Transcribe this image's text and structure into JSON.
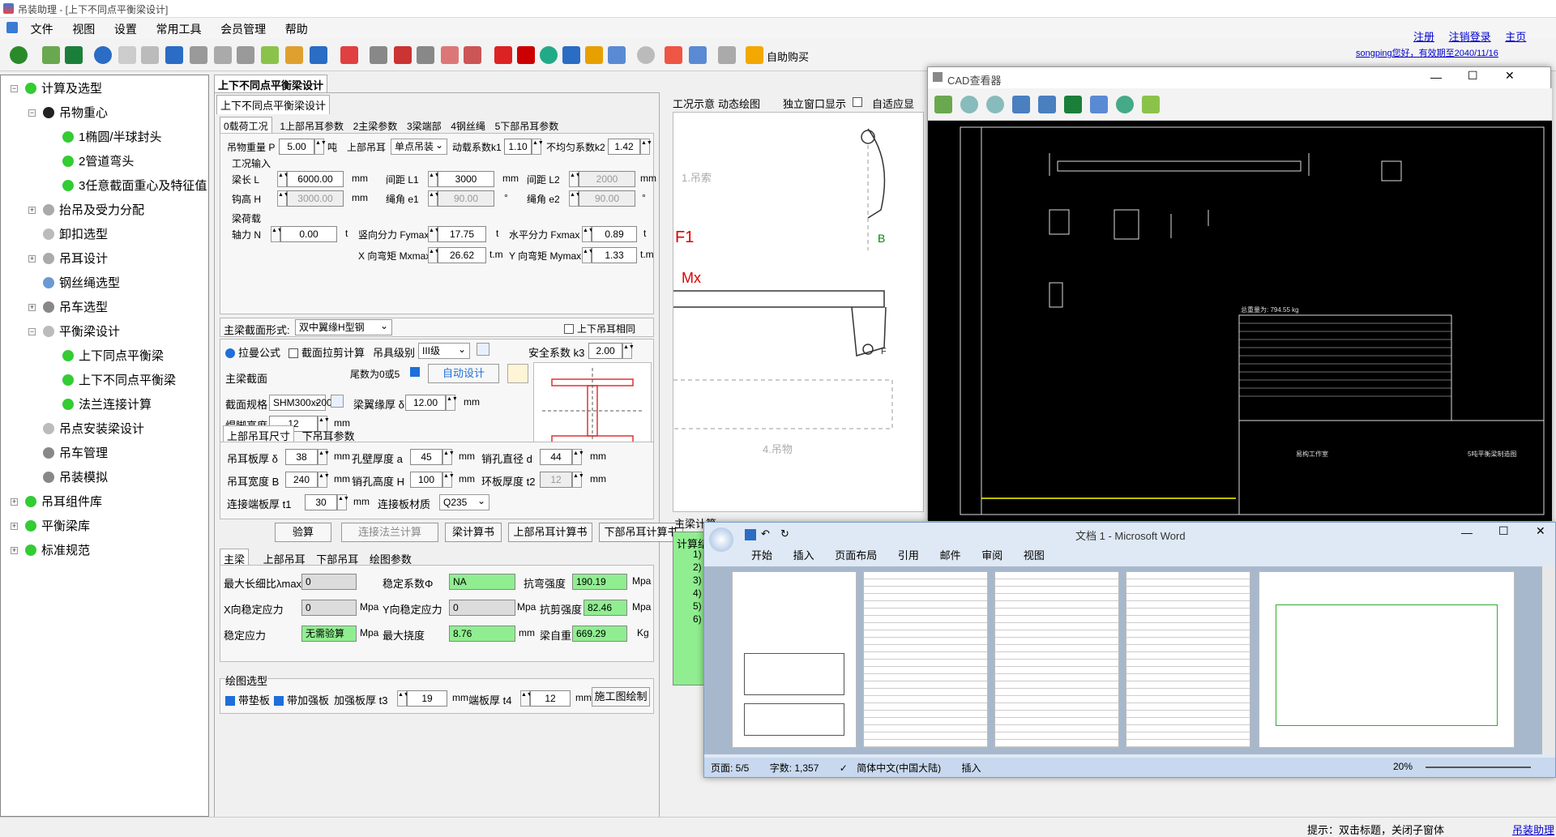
{
  "app": {
    "title": "吊装助理 - [上下不同点平衡梁设计]"
  },
  "menu": [
    "文件",
    "视图",
    "设置",
    "常用工具",
    "会员管理",
    "帮助"
  ],
  "toolbar": {
    "buy": "自助购买"
  },
  "links": {
    "register": "注册",
    "logout": "注销登录",
    "home": "主页",
    "user": "songping您好，有效期至2040/11/16"
  },
  "tree": {
    "calc": "计算及选型",
    "load_cg": "吊物重心",
    "cg1": "1椭圆/半球封头",
    "cg2": "2管道弯头",
    "cg3": "3任意截面重心及特征值",
    "lift": "抬吊及受力分配",
    "unload": "卸扣选型",
    "lug": "吊耳设计",
    "rope": "钢丝绳选型",
    "crane": "吊车选型",
    "beam": "平衡梁设计",
    "beam1": "上下同点平衡梁",
    "beam2": "上下不同点平衡梁",
    "beam3": "法兰连接计算",
    "hook_beam": "吊点安装梁设计",
    "crane_mgr": "吊车管理",
    "sim": "吊装模拟",
    "lug_lib": "吊耳组件库",
    "beam_lib": "平衡梁库",
    "std": "标准规范"
  },
  "doc_tab": "上下不同点平衡梁设计",
  "panel_title": "上下不同点平衡梁设计",
  "tabs1": [
    "0载荷工况",
    "1上部吊耳参数",
    "2主梁参数",
    "3梁端部",
    "4钢丝绳",
    "5下部吊耳参数"
  ],
  "load": {
    "weight_label": "吊物重量 P",
    "weight": "5.00",
    "weight_unit": "吨",
    "upper_lug": "上部吊耳",
    "upper_lug_val": "单点吊装",
    "k1_label": "动载系数k1",
    "k1": "1.10",
    "k2_label": "不均匀系数k2",
    "k2": "1.42",
    "cond": "工况输入",
    "L_label": "梁长 L",
    "L": "6000.00",
    "mm": "mm",
    "L1_label": "间距 L1",
    "L1": "3000",
    "L2_label": "间距 L2",
    "L2": "2000",
    "H_label": "钩高 H",
    "H": "3000.00",
    "e1_label": "绳角 e1",
    "e1": "90.00",
    "deg": "°",
    "e2_label": "绳角 e2",
    "e2": "90.00",
    "beam_load": "梁荷载",
    "N_label": "轴力 N",
    "N": "0.00",
    "t": "t",
    "Fy_label": "竖向分力 Fymax",
    "Fy": "17.75",
    "Fx_label": "水平分力 Fxmax",
    "Fx": "0.89",
    "Mx_label": "X 向弯矩 Mxmax",
    "Mx": "26.62",
    "tm": "t.m",
    "My_label": "Y 向弯矩 Mymax",
    "My": "1.33"
  },
  "section": {
    "form_label": "主梁截面形式:",
    "form": "双中翼缘H型钢",
    "same_lug": "上下吊耳相同",
    "formula": "拉曼公式",
    "shear": "截面拉剪计算",
    "grade_label": "吊具级别",
    "grade": "III级",
    "safety_label": "安全系数 k3",
    "safety": "2.00",
    "main_sec": "主梁截面",
    "tail": "尾数为0或5",
    "auto": "自动设计",
    "spec_label": "截面规格",
    "spec": "SHM300x200",
    "flange_label": "梁翼缘厚 δ",
    "flange": "12.00",
    "weld_label": "焊脚高度 F",
    "weld": "12"
  },
  "lug_tabs": [
    "上部吊耳尺寸",
    "下吊耳参数"
  ],
  "lug": {
    "thk_label": "吊耳板厚 δ",
    "thk": "38",
    "hole_label": "孔壁厚度 a",
    "hole": "45",
    "pin_label": "销孔直径 d",
    "pin": "44",
    "wid_label": "吊耳宽度 B",
    "wid": "240",
    "pinh_label": "销孔高度 H",
    "pinh": "100",
    "ring_label": "环板厚度 t2",
    "ring": "12",
    "con_label": "连接端板厚 t1",
    "con": "30",
    "mat_label": "连接板材质",
    "mat": "Q235"
  },
  "buttons": [
    "验算",
    "连接法兰计算",
    "梁计算书",
    "上部吊耳计算书",
    "下部吊耳计算书"
  ],
  "res_tabs": [
    "主梁",
    "上部吊耳",
    "下部吊耳",
    "绘图参数"
  ],
  "res": {
    "lam_label": "最大长细比λmax",
    "lam": "0",
    "stab_label": "稳定系数Φ",
    "stab": "NA",
    "bend_label": "抗弯强度",
    "bend": "190.19",
    "mpa": "Mpa",
    "xs_label": "X向稳定应力",
    "xs": "0",
    "ys_label": "Y向稳定应力",
    "ys": "0",
    "shear_label": "抗剪强度",
    "shear": "82.46",
    "st_label": "稳定应力",
    "st": "无需验算",
    "defl_label": "最大挠度",
    "defl": "8.76",
    "wt_label": "梁自重",
    "wt": "669.29",
    "kg": "Kg"
  },
  "draw": {
    "title": "绘图选型",
    "pad": "带垫板",
    "rib": "带加强板",
    "rib_t_label": "加强板厚 t3",
    "rib_t": "19",
    "end_t_label": "端板厚 t4",
    "end_t": "12",
    "draw_btn": "施工图绘制"
  },
  "preview": {
    "tab1": "工况示意",
    "tab2": "动态绘图",
    "standalone": "独立窗口显示",
    "adapt": "自适应显",
    "calc_title": "主梁计算",
    "calc_result": "计算结果",
    "result_lines": [
      "1)",
      "2)",
      "3)",
      "4)",
      "5)",
      "6)"
    ],
    "F1": "F1",
    "Mx": "Mx",
    "B": "B",
    "F": "F",
    "note1": "1.吊索",
    "note4": "4.吊物"
  },
  "cad": {
    "title": "CAD查看器",
    "total": "总重量为: 794.55 kg",
    "company": "易构工作室",
    "drawing": "5吨平衡梁制造图"
  },
  "word": {
    "title": "文档 1 - Microsoft Word",
    "ribbon": [
      "开始",
      "插入",
      "页面布局",
      "引用",
      "邮件",
      "审阅",
      "视图"
    ],
    "status_pages": "页面: 5/5",
    "status_words": "字数: 1,357",
    "status_lang": "简体中文(中国大陆)",
    "status_ins": "插入",
    "zoom": "20%"
  },
  "status": {
    "hint": "提示：双击标题，关闭子窗体",
    "help": "吊装助理"
  }
}
